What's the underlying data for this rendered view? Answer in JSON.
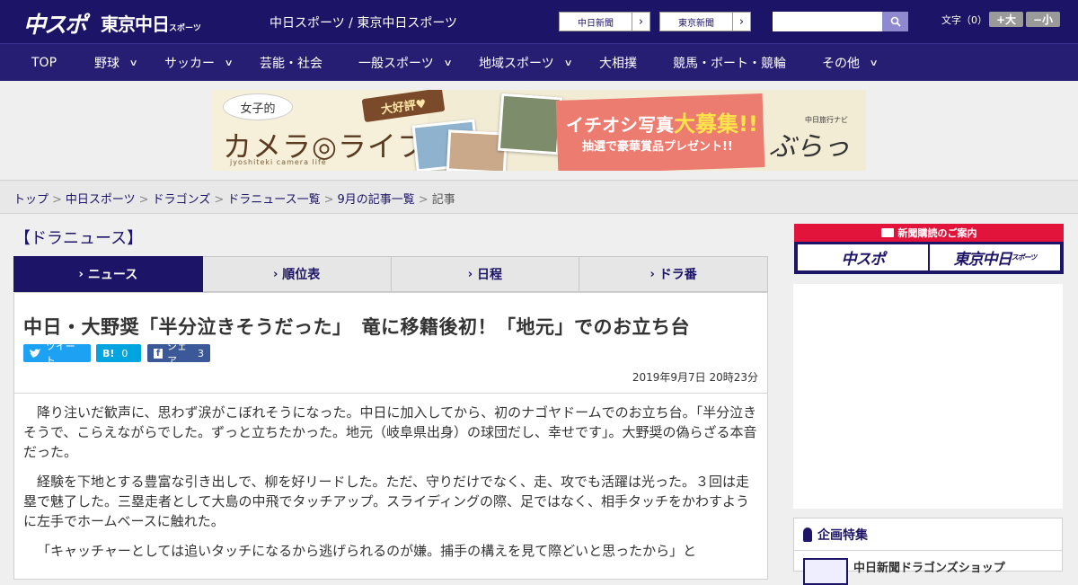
{
  "header": {
    "logo_main": "中スポ",
    "logo_tokyo": "東京中日",
    "logo_tokyo_sub": "スポーツ",
    "site_title": "中日スポーツ / 東京中日スポーツ",
    "links": [
      "中日新聞",
      "東京新聞"
    ],
    "search_placeholder": "",
    "font_size_label": "文字（0）",
    "font_bigger": "+大",
    "font_smaller": "−小"
  },
  "nav": {
    "items": [
      {
        "label": "TOP",
        "has_dropdown": false
      },
      {
        "label": "野球",
        "has_dropdown": true
      },
      {
        "label": "サッカー",
        "has_dropdown": true
      },
      {
        "label": "芸能・社会",
        "has_dropdown": false
      },
      {
        "label": "一般スポーツ",
        "has_dropdown": true
      },
      {
        "label": "地域スポーツ",
        "has_dropdown": true
      },
      {
        "label": "大相撲",
        "has_dropdown": false
      },
      {
        "label": "競馬・ボート・競輪",
        "has_dropdown": false
      },
      {
        "label": "その他",
        "has_dropdown": true
      }
    ]
  },
  "banner": {
    "bubble": "女子的",
    "title": "カメラ◎ライフ",
    "subtitle": "jyoshiteki camera life",
    "tag": "大好評♥",
    "headline_a": "イチオシ写真",
    "headline_big": "大募集!!",
    "sub": "抽選で豪華賞品プレゼント!!",
    "brand_label": "中日旅行ナビ",
    "brand": "ぶらっ人"
  },
  "breadcrumb": {
    "links": [
      "トップ",
      "中日スポーツ",
      "ドラゴンズ",
      "ドラニュース一覧",
      "9月の記事一覧"
    ],
    "current": "記事"
  },
  "section_title": "【ドラニュース】",
  "tabs": [
    {
      "label": "ニュース",
      "active": true
    },
    {
      "label": "順位表",
      "active": false
    },
    {
      "label": "日程",
      "active": false
    },
    {
      "label": "ドラ番",
      "active": false
    }
  ],
  "article": {
    "headline": "中日・大野奨「半分泣きそうだった」　竜に移籍後初！「地元」でのお立ち台",
    "share": {
      "tweet": "ツイート",
      "hatena_count": "0",
      "facebook": "シェア",
      "facebook_count": "3"
    },
    "date": "2019年9月7日 20時23分",
    "paragraphs": [
      "降り注いだ歓声に、思わず涙がこぼれそうになった。中日に加入してから、初のナゴヤドームでのお立ち台。「半分泣きそうで、こらえながらでした。ずっと立ちたかった。地元（岐阜県出身）の球団だし、幸せです」。大野奨の偽らざる本音だった。",
      "経験を下地とする豊富な引き出しで、柳を好リードした。ただ、守りだけでなく、走、攻でも活躍は光った。３回は走塁で魅了した。三塁走者として大島の中飛でタッチアップ。スライディングの際、足ではなく、相手タッチをかわすように左手でホームベースに触れた。",
      "「キャッチャーとしては追いタッチになるから逃げられるのが嫌。捕手の構えを見て際どいと思ったから」と"
    ]
  },
  "sidebar": {
    "subscription_head": "新聞購読のご案内",
    "subscription_buttons": [
      "中スポ",
      "東京中日"
    ],
    "subscription_button_sub": "スポーツ",
    "feature_title": "企画特集",
    "feature_item": "中日新聞ドラゴンズショップ"
  },
  "colors": {
    "brand_navy": "#1c1466",
    "accent_red": "#e3143c",
    "twitter": "#1da1f2",
    "hatena": "#00a4de",
    "facebook": "#3b5998"
  }
}
